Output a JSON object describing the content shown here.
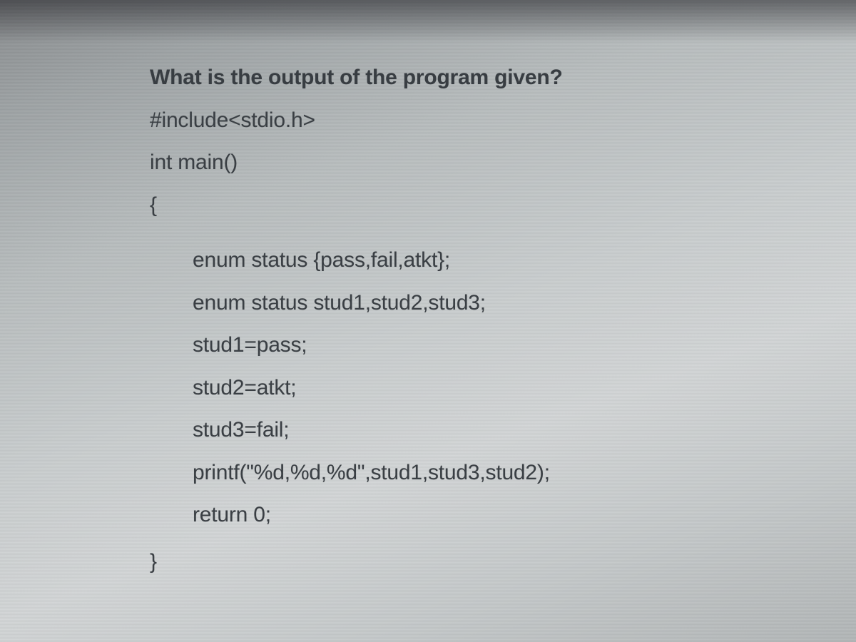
{
  "question": {
    "prompt": "What is the output of the program given?"
  },
  "code": {
    "l1": "#include<stdio.h>",
    "l2": "int main()",
    "l3": "{",
    "l4": "enum status {pass,fail,atkt};",
    "l5": "enum status stud1,stud2,stud3;",
    "l6": "stud1=pass;",
    "l7": "stud2=atkt;",
    "l8": "stud3=fail;",
    "l9": "printf(\"%d,%d,%d\",stud1,stud3,stud2);",
    "l10": "return 0;",
    "l11": "}"
  }
}
